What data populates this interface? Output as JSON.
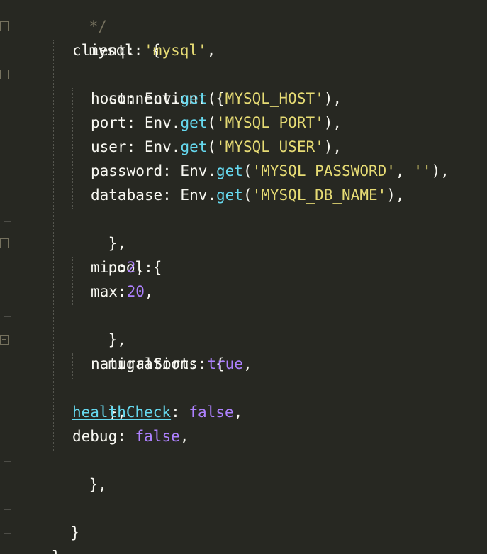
{
  "code": {
    "comment_end": "*/",
    "l_mysql": "mysql: {",
    "l_client_key": "client: ",
    "l_client_val": "'mysql'",
    "l_conn": "connection: {",
    "host_key": "host: Env.",
    "host_arg": "'MYSQL_HOST'",
    "port_key": "port: Env.",
    "port_arg": "'MYSQL_PORT'",
    "user_key": "user: Env.",
    "user_arg": "'MYSQL_USER'",
    "pass_key": "password: Env.",
    "pass_arg": "'MYSQL_PASSWORD'",
    "pass_arg2": "''",
    "db_key": "database: Env.",
    "db_arg": "'MYSQL_DB_NAME'",
    "get_fn": "get",
    "close_comma": "},",
    "pool": "pool:{",
    "min_key": "min:",
    "min_val": "2",
    "max_key": "max:",
    "max_val": "20",
    "migrations": "migrations: {",
    "natural_key": "naturalSort: ",
    "natural_val": "true",
    "health_key": "healthCheck",
    "health_val": "false",
    "debug_key": "debug: ",
    "debug_val": "false",
    "inner_close": "}",
    "outer_close": "}"
  },
  "colors": {
    "background": "#272822",
    "string": "#e6db74",
    "function": "#66d9ef",
    "number": "#ae81ff",
    "text": "#f8f8f2"
  }
}
